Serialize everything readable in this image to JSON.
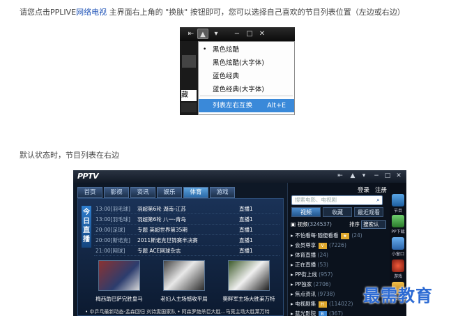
{
  "intro": {
    "before": "请您点击PPLIVE",
    "link": "网络电视",
    "after": " 主界面右上角的 \"换肤\" 按钮即可，您可以选择自己喜欢的节目列表位置（左边或右边）"
  },
  "dropdown": {
    "left_caption": "藏",
    "items": [
      {
        "label": "黑色炫酷",
        "checked": true
      },
      {
        "label": "黑色炫酷(大字体)",
        "checked": false
      },
      {
        "label": "蓝色经典",
        "checked": false
      },
      {
        "label": "蓝色经典(大字体)",
        "checked": false
      }
    ],
    "action": {
      "label": "列表左右互换",
      "shortcut": "Alt+E"
    }
  },
  "caption2": "默认状态时，节目列表在右边",
  "pptv": {
    "logo": "PPTV",
    "tabs": [
      "首页",
      "影视",
      "资讯",
      "娱乐",
      "体育",
      "游戏"
    ],
    "active_tab": "体育",
    "today_label": "今日直播",
    "schedule": [
      {
        "time": "13:00[羽毛球]",
        "title": "羽超第6轮 湖南-江苏",
        "status": "直播1"
      },
      {
        "time": "13:00[羽毛球]",
        "title": "羽超第6轮 八一-青岛",
        "status": "直播1"
      },
      {
        "time": "20:00[足球]",
        "title": "专题 英超世界第35期",
        "status": "直播1"
      },
      {
        "time": "20:00[斯诺克]",
        "title": "2011斯诺克世锦赛半决赛",
        "status": "直播1"
      },
      {
        "time": "21:00[网球]",
        "title": "专题 ACE网球杂志",
        "status": "直播1"
      }
    ],
    "thumbs": [
      {
        "caption": "梅西助巴萨完胜皇马",
        "color": "#7a3a3a"
      },
      {
        "caption": "老妇人主场憾收平局",
        "color": "#3c4a3a"
      },
      {
        "caption": "樊畔军主场大胜莱万特",
        "color": "#5b4e3a"
      }
    ],
    "ticker": "• 中乒乓最新动态-孟森回归 刘诗雯国家队 • 阿森罗绝杀巨大胜…马竞主场大胜莱万特",
    "right": {
      "login": "登录",
      "register": "注册",
      "search_placeholder": "搜索电影、电视剧",
      "tabs": [
        "视频",
        "收藏",
        "最近观看"
      ],
      "header_label": "视频",
      "header_count": "(324537)",
      "sort_label": "排序",
      "sort_value": "搜索认",
      "list": [
        {
          "label": "不怕看每·随便看看",
          "count": "(24)",
          "badge": "star"
        },
        {
          "label": "会员尊享",
          "count": "(7226)",
          "badge": "VIP"
        },
        {
          "label": "体育直播",
          "count": "(24)",
          "badge": ""
        },
        {
          "label": "正在直播",
          "count": "(53)",
          "badge": ""
        },
        {
          "label": "PP街上线",
          "count": "(957)",
          "badge": ""
        },
        {
          "label": "PP独家",
          "count": "(2706)",
          "badge": ""
        },
        {
          "label": "焦点资讯",
          "count": "(9738)",
          "badge": ""
        },
        {
          "label": "电视剧集",
          "count": "(114022)",
          "badge": "HOT"
        },
        {
          "label": "蓝光影院",
          "count": "(367)",
          "badge": "blue"
        }
      ]
    },
    "dock": [
      "节目",
      "PP下载",
      "小窗口",
      "游戏",
      "会员"
    ]
  },
  "watermark": "最需教育"
}
